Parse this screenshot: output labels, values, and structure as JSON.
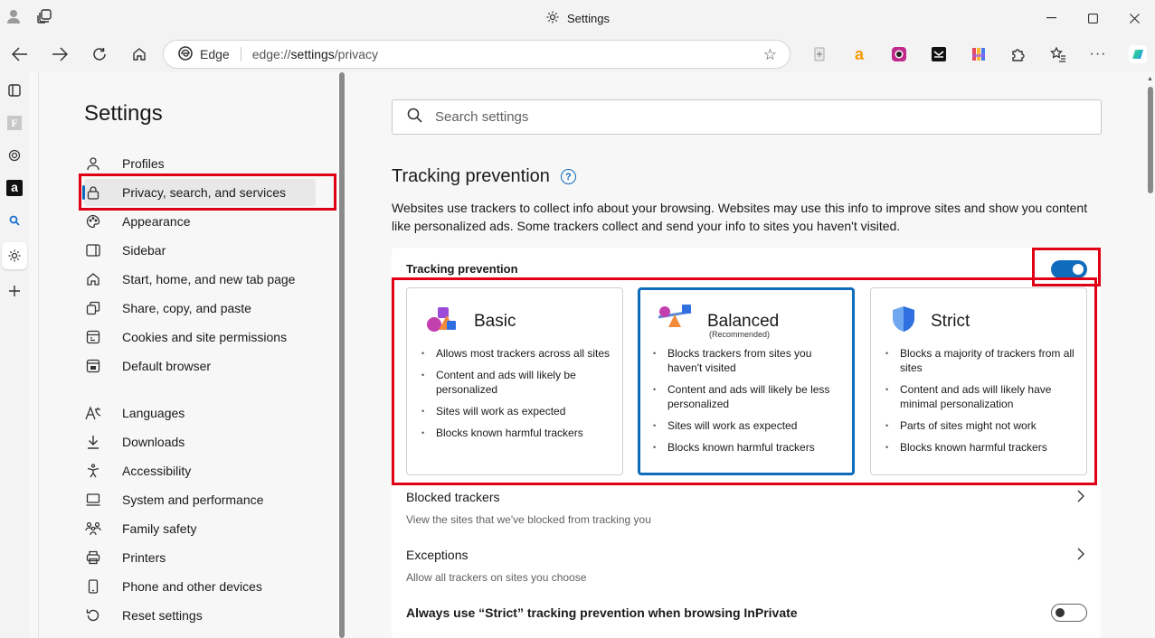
{
  "window": {
    "title": "Settings"
  },
  "addressbar": {
    "browser_label": "Edge",
    "url_prefix": "edge://",
    "url_bold": "settings",
    "url_suffix": "/privacy"
  },
  "settings_nav": {
    "title": "Settings",
    "items": [
      {
        "label": "Profiles",
        "icon": "profile-icon"
      },
      {
        "label": "Privacy, search, and services",
        "icon": "lock-icon"
      },
      {
        "label": "Appearance",
        "icon": "appearance-icon"
      },
      {
        "label": "Sidebar",
        "icon": "sidebar-icon"
      },
      {
        "label": "Start, home, and new tab page",
        "icon": "home-icon"
      },
      {
        "label": "Share, copy, and paste",
        "icon": "share-icon"
      },
      {
        "label": "Cookies and site permissions",
        "icon": "cookies-icon"
      },
      {
        "label": "Default browser",
        "icon": "browser-icon"
      },
      {
        "label": "Languages",
        "icon": "languages-icon"
      },
      {
        "label": "Downloads",
        "icon": "download-icon"
      },
      {
        "label": "Accessibility",
        "icon": "accessibility-icon"
      },
      {
        "label": "System and performance",
        "icon": "system-icon"
      },
      {
        "label": "Family safety",
        "icon": "family-icon"
      },
      {
        "label": "Printers",
        "icon": "printer-icon"
      },
      {
        "label": "Phone and other devices",
        "icon": "phone-icon"
      },
      {
        "label": "Reset settings",
        "icon": "reset-icon"
      }
    ]
  },
  "search": {
    "placeholder": "Search settings"
  },
  "tracking": {
    "section_title": "Tracking prevention",
    "description": "Websites use trackers to collect info about your browsing. Websites may use this info to improve sites and show you content like personalized ads. Some trackers collect and send your info to sites you haven't visited.",
    "toggle_label": "Tracking prevention",
    "toggle_on": true,
    "options": {
      "basic": {
        "name": "Basic",
        "bullets": [
          "Allows most trackers across all sites",
          "Content and ads will likely be personalized",
          "Sites will work as expected",
          "Blocks known harmful trackers"
        ]
      },
      "balanced": {
        "name": "Balanced",
        "recommended": "(Recommended)",
        "bullets": [
          "Blocks trackers from sites you haven't visited",
          "Content and ads will likely be less personalized",
          "Sites will work as expected",
          "Blocks known harmful trackers"
        ]
      },
      "strict": {
        "name": "Strict",
        "bullets": [
          "Blocks a majority of trackers from all sites",
          "Content and ads will likely have minimal personalization",
          "Parts of sites might not work",
          "Blocks known harmful trackers"
        ]
      }
    },
    "selected_option": "Balanced",
    "blocked_trackers": {
      "title": "Blocked trackers",
      "subtitle": "View the sites that we've blocked from tracking you"
    },
    "exceptions": {
      "title": "Exceptions",
      "subtitle": "Allow all trackers on sites you choose"
    },
    "inprivate": {
      "title": "Always use “Strict” tracking prevention when browsing InPrivate",
      "toggle_on": false
    }
  },
  "colors": {
    "accent": "#0f6cbd",
    "highlight_box": "#e00015"
  }
}
